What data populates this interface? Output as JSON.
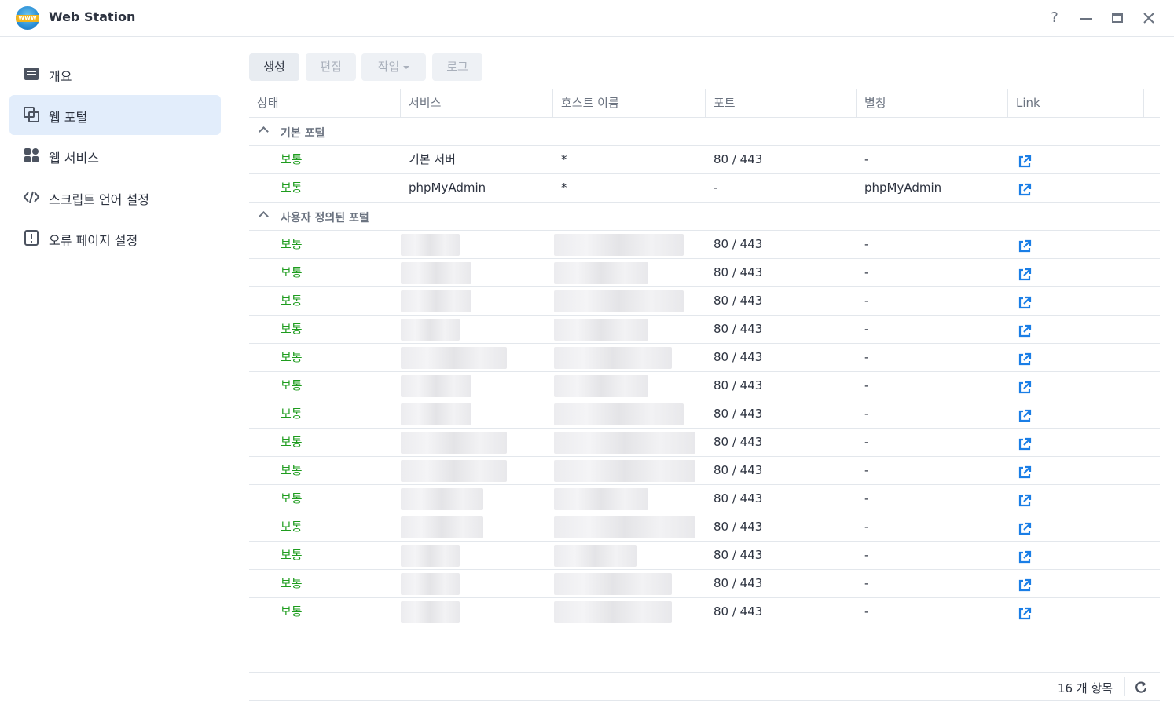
{
  "window": {
    "title": "Web Station",
    "logo_text": "WWW"
  },
  "sidebar": {
    "items": [
      {
        "label": "개요"
      },
      {
        "label": "웹 포털"
      },
      {
        "label": "웹 서비스"
      },
      {
        "label": "스크립트 언어 설정"
      },
      {
        "label": "오류 페이지 설정"
      }
    ],
    "active_index": 1
  },
  "toolbar": {
    "create_label": "생성",
    "edit_label": "편집",
    "action_label": "작업",
    "log_label": "로그"
  },
  "table": {
    "columns": [
      "상태",
      "서비스",
      "호스트 이름",
      "포트",
      "별칭",
      "Link"
    ],
    "groups": [
      {
        "label": "기본 포털",
        "rows": [
          {
            "status": "보통",
            "service": "기본 서버",
            "host": "*",
            "port": "80 / 443",
            "alias": "-"
          },
          {
            "status": "보통",
            "service": "phpMyAdmin",
            "host": "*",
            "port": "-",
            "alias": "phpMyAdmin"
          }
        ]
      },
      {
        "label": "사용자 정의된 포털",
        "rows": [
          {
            "status": "보통",
            "port": "80 / 443",
            "alias": "-"
          },
          {
            "status": "보통",
            "port": "80 / 443",
            "alias": "-"
          },
          {
            "status": "보통",
            "port": "80 / 443",
            "alias": "-"
          },
          {
            "status": "보통",
            "port": "80 / 443",
            "alias": "-"
          },
          {
            "status": "보통",
            "port": "80 / 443",
            "alias": "-"
          },
          {
            "status": "보통",
            "port": "80 / 443",
            "alias": "-"
          },
          {
            "status": "보통",
            "port": "80 / 443",
            "alias": "-"
          },
          {
            "status": "보통",
            "port": "80 / 443",
            "alias": "-"
          },
          {
            "status": "보통",
            "port": "80 / 443",
            "alias": "-"
          },
          {
            "status": "보통",
            "port": "80 / 443",
            "alias": "-"
          },
          {
            "status": "보통",
            "port": "80 / 443",
            "alias": "-"
          },
          {
            "status": "보통",
            "port": "80 / 443",
            "alias": "-"
          },
          {
            "status": "보통",
            "port": "80 / 443",
            "alias": "-"
          },
          {
            "status": "보통",
            "port": "80 / 443",
            "alias": "-"
          }
        ]
      }
    ]
  },
  "footer": {
    "count_label": "16 개 항목"
  },
  "colors": {
    "status_ok": "#1e9c1e",
    "link_icon": "#1a7ee6",
    "active_nav": "#e2edfb"
  },
  "icons": [
    "help-icon",
    "minimize-icon",
    "maximize-icon",
    "close-icon",
    "overview-icon",
    "web-portal-icon",
    "web-service-icon",
    "script-language-icon",
    "error-page-icon",
    "external-link-icon",
    "refresh-icon",
    "chevron-up-icon"
  ]
}
